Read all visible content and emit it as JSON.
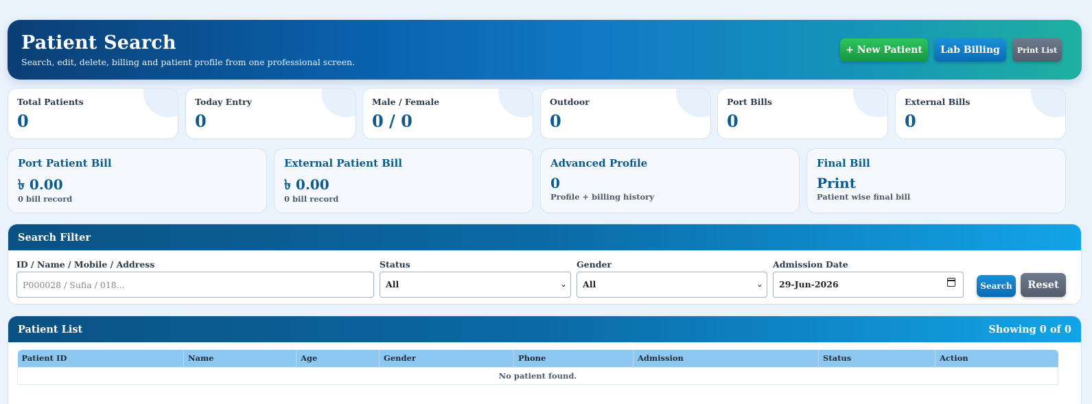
{
  "header": {
    "title": "Patient Search",
    "subtitle": "Search, edit, delete, billing and patient profile from one professional screen.",
    "new_patient_label": "+ New Patient",
    "lab_billing_label": "Lab Billing",
    "print_list_label": "Print List"
  },
  "stats": [
    {
      "label": "Total Patients",
      "value": "0"
    },
    {
      "label": "Today Entry",
      "value": "0"
    },
    {
      "label": "Male / Female",
      "value": "0 / 0"
    },
    {
      "label": "Outdoor",
      "value": "0"
    },
    {
      "label": "Port Bills",
      "value": "0"
    },
    {
      "label": "External Bills",
      "value": "0"
    }
  ],
  "cards": [
    {
      "title": "Port Patient Bill",
      "value": "৳ 0.00",
      "sub": "0 bill record"
    },
    {
      "title": "External Patient Bill",
      "value": "৳ 0.00",
      "sub": "0 bill record"
    },
    {
      "title": "Advanced Profile",
      "value": "0",
      "sub": "Profile + billing history"
    },
    {
      "title": "Final Bill",
      "value": "Print",
      "sub": "Patient wise final bill"
    }
  ],
  "filter": {
    "title": "Search Filter",
    "query_label": "ID / Name / Mobile / Address",
    "query_placeholder": "P000028 / Sufia / 018...",
    "status_label": "Status",
    "status_value": "All",
    "gender_label": "Gender",
    "gender_value": "All",
    "date_label": "Admission Date",
    "date_value": "29-Jun-2026",
    "search_label": "Search",
    "reset_label": "Reset"
  },
  "list": {
    "title": "Patient List",
    "showing": "Showing 0 of 0",
    "columns": [
      "Patient ID",
      "Name",
      "Age",
      "Gender",
      "Phone",
      "Admission",
      "Status",
      "Action"
    ],
    "empty_text": "No patient found."
  },
  "colors": {
    "brand_dark": "#0b3f75",
    "accent_teal": "#1fb0a0",
    "value_blue": "#0c5b8c",
    "green_button": "#159640",
    "table_header": "#8cc8f1"
  }
}
